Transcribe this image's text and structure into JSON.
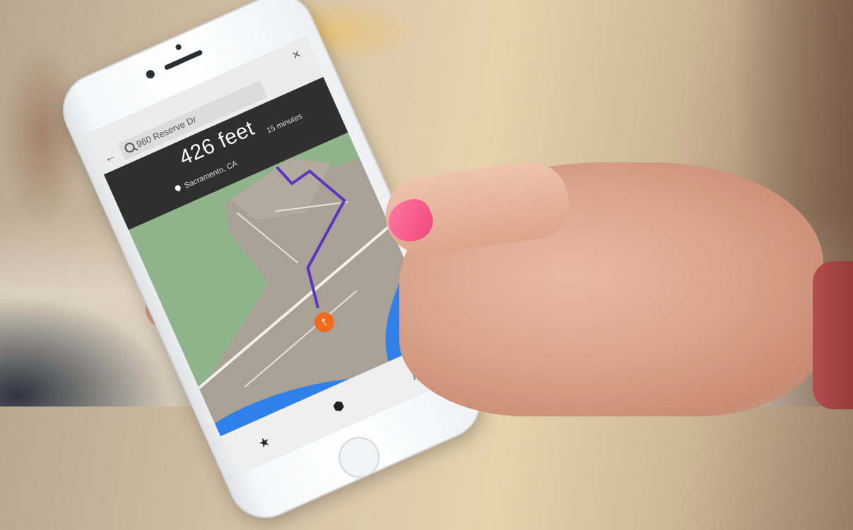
{
  "search": {
    "query": "960 Reserve Dr",
    "close_label": "×",
    "back_label": "←"
  },
  "navigation": {
    "distance": "426 feet",
    "duration": "15 minutes",
    "location": "Sacramento, CA"
  },
  "map": {
    "route_color": "#5b35c2",
    "water_color": "#2f80e8",
    "land_color": "#a9a096",
    "park_color": "#8fb38a"
  },
  "bottom_bar": {
    "icons": [
      "star-icon",
      "cube-icon",
      "person-icon"
    ]
  }
}
